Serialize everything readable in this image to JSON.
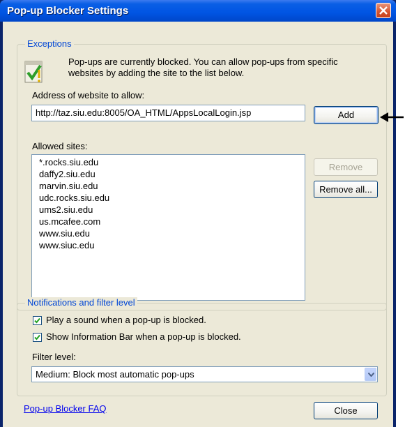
{
  "window": {
    "title": "Pop-up Blocker Settings"
  },
  "exceptions": {
    "legend": "Exceptions",
    "info_line1": "Pop-ups are currently blocked.  You can allow pop-ups from specific",
    "info_line2": "websites by adding the site to the list below.",
    "address_label": "Address of website to allow:",
    "address_value": "http://taz.siu.edu:8005/OA_HTML/AppsLocalLogin.jsp",
    "add_label": "Add",
    "allowed_label": "Allowed sites:",
    "allowed_sites": [
      "*.rocks.siu.edu",
      "daffy2.siu.edu",
      "marvin.siu.edu",
      "udc.rocks.siu.edu",
      "ums2.siu.edu",
      "us.mcafee.com",
      "www.siu.edu",
      "www.siuc.edu"
    ],
    "remove_label": "Remove",
    "remove_all_label": "Remove all..."
  },
  "notifications": {
    "legend": "Notifications and filter level",
    "play_sound_label": "Play a sound when a pop-up is blocked.",
    "play_sound_checked": true,
    "info_bar_label": "Show Information Bar when a pop-up is blocked.",
    "info_bar_checked": true,
    "filter_label": "Filter level:",
    "filter_value": "Medium: Block most automatic pop-ups"
  },
  "footer": {
    "faq_link": "Pop-up Blocker FAQ",
    "close_label": "Close"
  },
  "colors": {
    "titlebar": "#0054e3",
    "group_legend": "#0046d5",
    "dialog_bg": "#ece9d8",
    "link": "#0000ee"
  },
  "icons": [
    "close-icon",
    "shield-check-icon",
    "checkmark-icon",
    "dropdown-arrow-icon",
    "pointer-arrow-icon"
  ]
}
